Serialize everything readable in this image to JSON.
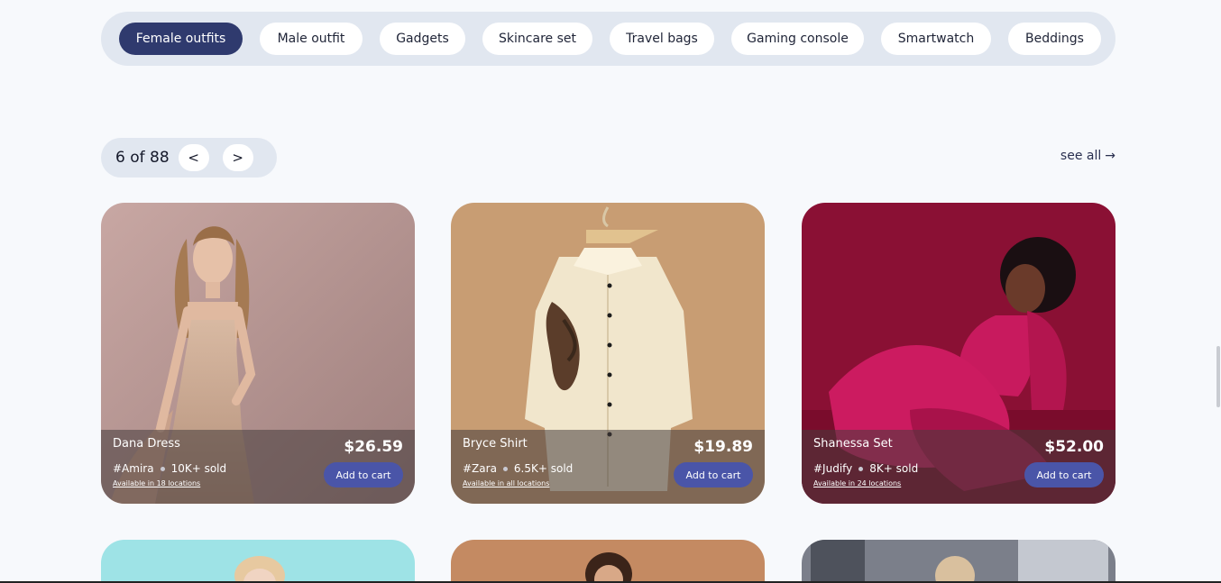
{
  "categories": [
    {
      "label": "Female outfits",
      "active": true
    },
    {
      "label": "Male outfit"
    },
    {
      "label": "Gadgets"
    },
    {
      "label": "Skincare set"
    },
    {
      "label": "Travel bags"
    },
    {
      "label": "Gaming console"
    },
    {
      "label": "Smartwatch"
    },
    {
      "label": "Beddings"
    }
  ],
  "pager": {
    "text": "6 of 88",
    "prev": "<",
    "next": ">"
  },
  "see_all": "see all",
  "see_all_arrow": "→",
  "products": [
    {
      "name": "Dana Dress",
      "price": "$26.59",
      "brand": "#Amira",
      "sold": "10K+ sold",
      "availability": "Available in 18 locations",
      "cta": "Add to cart"
    },
    {
      "name": "Bryce Shirt",
      "price": "$19.89",
      "brand": "#Zara",
      "sold": "6.5K+ sold",
      "availability": "Available in all locations",
      "cta": "Add to cart"
    },
    {
      "name": "Shanessa Set",
      "price": "$52.00",
      "brand": "#Judify",
      "sold": "8K+ sold",
      "availability": "Available in 24 locations",
      "cta": "Add to cart"
    }
  ],
  "colors": {
    "active_pill": "#2f3a6e",
    "cart_button": "#4a55a8",
    "page_bg": "#f7f9fc"
  }
}
